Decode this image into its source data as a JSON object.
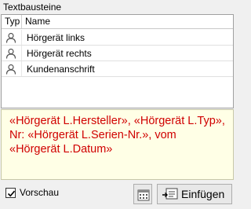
{
  "panel": {
    "title": "Textbausteine"
  },
  "list": {
    "columns": {
      "typ": "Typ",
      "name": "Name"
    },
    "items": [
      {
        "icon": "person-icon",
        "label": "Hörgerät links"
      },
      {
        "icon": "person-icon",
        "label": "Hörgerät rechts"
      },
      {
        "icon": "person-icon",
        "label": "Kundenanschrift"
      }
    ]
  },
  "preview": {
    "parts": [
      "«Hörgerät L.Hersteller»",
      ", ",
      "«Hörgerät L.Typ»",
      ", Nr: ",
      "«Hörgerät L.Serien-Nr.»",
      ", vom ",
      "«Hörgerät L.Datum»"
    ],
    "color": "#d00000",
    "background": "#ffffe6"
  },
  "footer": {
    "preview_checkbox": {
      "label": "Vorschau",
      "checked": true
    },
    "calendar_button_icon": "calendar-icon",
    "insert_button": {
      "label": "Einfügen",
      "icon": "insert-icon"
    }
  }
}
